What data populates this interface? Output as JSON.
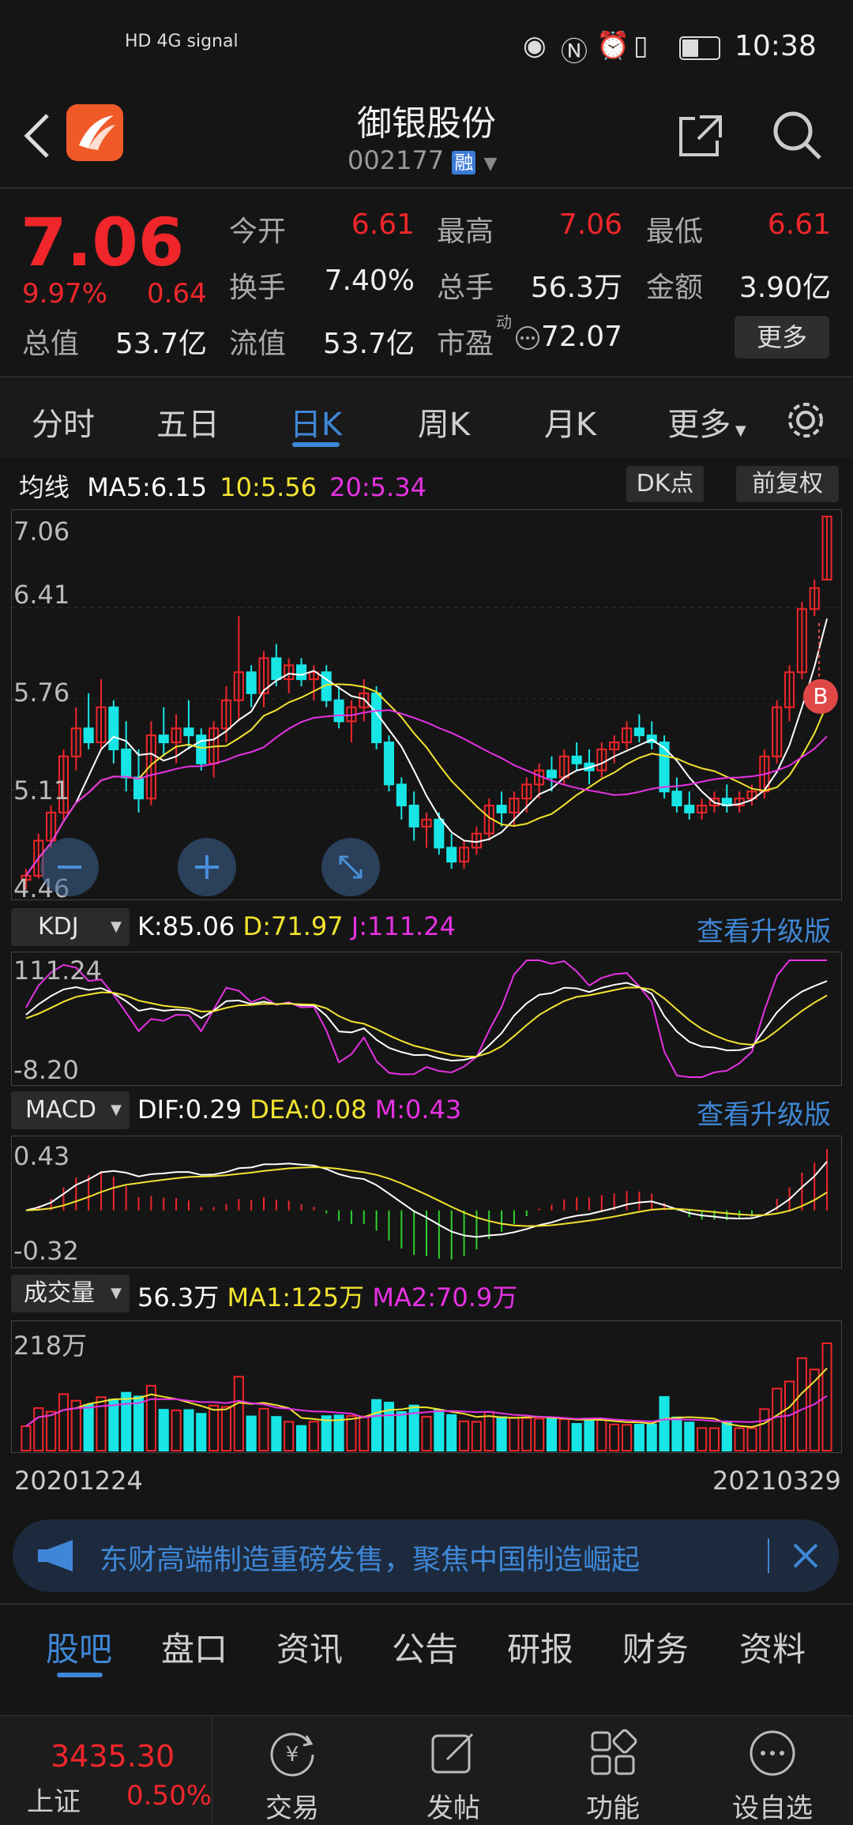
{
  "status_bar": {
    "left_icons": "HD 4G signal",
    "time": "10:38",
    "battery_icon": "battery-icon"
  },
  "header": {
    "title": "御银股份",
    "code": "002177",
    "margin_tag": "融"
  },
  "quote": {
    "price": "7.06",
    "change_pct": "9.97%",
    "change": "0.64",
    "rows": [
      [
        {
          "label": "今开",
          "value": "6.61",
          "color": "red"
        },
        {
          "label": "最高",
          "value": "7.06",
          "color": "red"
        },
        {
          "label": "最低",
          "value": "6.61",
          "color": "red"
        }
      ],
      [
        {
          "label": "换手",
          "value": "7.40%",
          "color": "white"
        },
        {
          "label": "总手",
          "value": "56.3万",
          "color": "white"
        },
        {
          "label": "金额",
          "value": "3.90亿",
          "color": "white"
        }
      ],
      [
        {
          "label": "总值",
          "value": "53.7亿",
          "color": "white"
        },
        {
          "label": "流值",
          "value": "53.7亿",
          "color": "white"
        },
        {
          "label": "市盈",
          "value": "72.07",
          "color": "white"
        }
      ]
    ],
    "pe_superscript": "动",
    "more_button": "更多"
  },
  "period_tabs": [
    "分时",
    "五日",
    "日K",
    "周K",
    "月K",
    "更多"
  ],
  "active_period": "日K",
  "ma_legend": {
    "label": "均线",
    "ma5": "MA5:6.15",
    "ma10": "10:5.56",
    "ma20": "20:5.34"
  },
  "chart_buttons": {
    "dk": "DK点",
    "fq": "前复权"
  },
  "kline": {
    "y_labels": [
      "7.06",
      "6.41",
      "5.76",
      "5.11",
      "4.46"
    ],
    "marker": "B"
  },
  "kdj": {
    "selector": "KDJ",
    "k": "K:85.06",
    "d": "D:71.97",
    "j": "J:111.24",
    "upgrade": "查看升级版",
    "y_top": "111.24",
    "y_bottom": "-8.20"
  },
  "macd": {
    "selector": "MACD",
    "dif": "DIF:0.29",
    "dea": "DEA:0.08",
    "m": "M:0.43",
    "upgrade": "查看升级版",
    "y_top": "0.43",
    "y_bottom": "-0.32"
  },
  "volume": {
    "selector": "成交量",
    "value": "56.3万",
    "ma1": "MA1:125万",
    "ma2": "MA2:70.9万",
    "y_top": "218万"
  },
  "dates": {
    "start": "20201224",
    "end": "20210329"
  },
  "banner": {
    "text": "东财高端制造重磅发售，聚焦中国制造崛起"
  },
  "bottom_tabs": [
    "股吧",
    "盘口",
    "资讯",
    "公告",
    "研报",
    "财务",
    "资料"
  ],
  "active_bottom_tab": "股吧",
  "index": {
    "value": "3435.30",
    "name": "上证",
    "pct": "0.50%"
  },
  "nav": [
    "交易",
    "发帖",
    "功能",
    "设自选"
  ],
  "colors": {
    "up": "#f0262b",
    "down": "#18e6e6",
    "ma5": "#ffffff",
    "ma10": "#f2e330",
    "ma20": "#e632e3",
    "accent": "#3f87d6"
  },
  "chart_data": [
    {
      "type": "candlestick",
      "title": "日K",
      "x_range": [
        "20201224",
        "20210329"
      ],
      "ylim": [
        4.46,
        7.06
      ],
      "last_candle": {
        "open": 6.61,
        "high": 7.06,
        "low": 6.61,
        "close": 7.06
      },
      "ma": {
        "MA5": 6.15,
        "MA10": 5.56,
        "MA20": 5.34
      },
      "candles": [
        [
          4.47,
          4.55,
          4.4,
          4.5
        ],
        [
          4.5,
          4.8,
          4.48,
          4.75
        ],
        [
          4.75,
          5.0,
          4.7,
          4.95
        ],
        [
          4.95,
          5.4,
          4.9,
          5.35
        ],
        [
          5.35,
          5.7,
          5.25,
          5.55
        ],
        [
          5.55,
          5.8,
          5.4,
          5.45
        ],
        [
          5.45,
          5.9,
          5.4,
          5.7
        ],
        [
          5.7,
          5.75,
          5.3,
          5.4
        ],
        [
          5.4,
          5.6,
          5.1,
          5.2
        ],
        [
          5.2,
          5.4,
          4.95,
          5.05
        ],
        [
          5.05,
          5.6,
          5.0,
          5.5
        ],
        [
          5.5,
          5.7,
          5.35,
          5.45
        ],
        [
          5.45,
          5.65,
          5.3,
          5.55
        ],
        [
          5.55,
          5.75,
          5.4,
          5.5
        ],
        [
          5.5,
          5.55,
          5.25,
          5.3
        ],
        [
          5.3,
          5.6,
          5.2,
          5.55
        ],
        [
          5.55,
          5.85,
          5.45,
          5.75
        ],
        [
          5.75,
          6.35,
          5.6,
          5.95
        ],
        [
          5.95,
          6.0,
          5.7,
          5.8
        ],
        [
          5.8,
          6.1,
          5.7,
          6.05
        ],
        [
          6.05,
          6.15,
          5.85,
          5.9
        ],
        [
          5.9,
          6.05,
          5.8,
          6.0
        ],
        [
          6.0,
          6.05,
          5.85,
          5.9
        ],
        [
          5.9,
          6.0,
          5.75,
          5.95
        ],
        [
          5.95,
          6.0,
          5.7,
          5.75
        ],
        [
          5.75,
          5.85,
          5.55,
          5.6
        ],
        [
          5.6,
          5.75,
          5.45,
          5.7
        ],
        [
          5.7,
          5.9,
          5.6,
          5.8
        ],
        [
          5.8,
          5.85,
          5.4,
          5.45
        ],
        [
          5.45,
          5.5,
          5.1,
          5.15
        ],
        [
          5.15,
          5.2,
          4.9,
          5.0
        ],
        [
          5.0,
          5.1,
          4.75,
          4.85
        ],
        [
          4.85,
          4.95,
          4.7,
          4.9
        ],
        [
          4.9,
          4.95,
          4.65,
          4.7
        ],
        [
          4.7,
          4.8,
          4.55,
          4.6
        ],
        [
          4.6,
          4.75,
          4.55,
          4.7
        ],
        [
          4.7,
          4.85,
          4.65,
          4.8
        ],
        [
          4.8,
          5.05,
          4.75,
          5.0
        ],
        [
          5.0,
          5.1,
          4.85,
          4.95
        ],
        [
          4.95,
          5.1,
          4.85,
          5.05
        ],
        [
          5.05,
          5.2,
          4.95,
          5.15
        ],
        [
          5.15,
          5.3,
          5.05,
          5.25
        ],
        [
          5.25,
          5.35,
          5.1,
          5.2
        ],
        [
          5.2,
          5.4,
          5.15,
          5.35
        ],
        [
          5.35,
          5.45,
          5.25,
          5.3
        ],
        [
          5.3,
          5.4,
          5.15,
          5.25
        ],
        [
          5.25,
          5.45,
          5.2,
          5.4
        ],
        [
          5.4,
          5.5,
          5.3,
          5.45
        ],
        [
          5.45,
          5.6,
          5.4,
          5.55
        ],
        [
          5.55,
          5.65,
          5.45,
          5.5
        ],
        [
          5.5,
          5.6,
          5.4,
          5.45
        ],
        [
          5.45,
          5.5,
          5.05,
          5.1
        ],
        [
          5.1,
          5.2,
          4.95,
          5.0
        ],
        [
          5.0,
          5.1,
          4.9,
          4.95
        ],
        [
          4.95,
          5.05,
          4.9,
          5.0
        ],
        [
          5.0,
          5.1,
          4.95,
          5.05
        ],
        [
          5.05,
          5.15,
          4.95,
          5.0
        ],
        [
          5.0,
          5.1,
          4.95,
          5.05
        ],
        [
          5.05,
          5.15,
          5.0,
          5.1
        ],
        [
          5.1,
          5.4,
          5.05,
          5.35
        ],
        [
          5.35,
          5.75,
          5.3,
          5.7
        ],
        [
          5.7,
          6.0,
          5.6,
          5.95
        ],
        [
          5.95,
          6.45,
          5.9,
          6.4
        ],
        [
          6.4,
          6.61,
          6.35,
          6.55
        ],
        [
          6.61,
          7.06,
          6.61,
          7.06
        ]
      ]
    },
    {
      "type": "line",
      "title": "KDJ",
      "series": [
        {
          "name": "K",
          "last": 85.06
        },
        {
          "name": "D",
          "last": 71.97
        },
        {
          "name": "J",
          "last": 111.24
        }
      ],
      "ylim": [
        -8.2,
        111.24
      ]
    },
    {
      "type": "bar",
      "title": "MACD",
      "series": [
        {
          "name": "DIF",
          "last": 0.29
        },
        {
          "name": "DEA",
          "last": 0.08
        },
        {
          "name": "M",
          "last": 0.43
        }
      ],
      "ylim": [
        -0.32,
        0.43
      ]
    },
    {
      "type": "bar",
      "title": "成交量",
      "series": [
        {
          "name": "VOL",
          "last": "56.3万"
        },
        {
          "name": "MA1",
          "last": "125万"
        },
        {
          "name": "MA2",
          "last": "70.9万"
        }
      ],
      "ymax": "218万"
    }
  ]
}
